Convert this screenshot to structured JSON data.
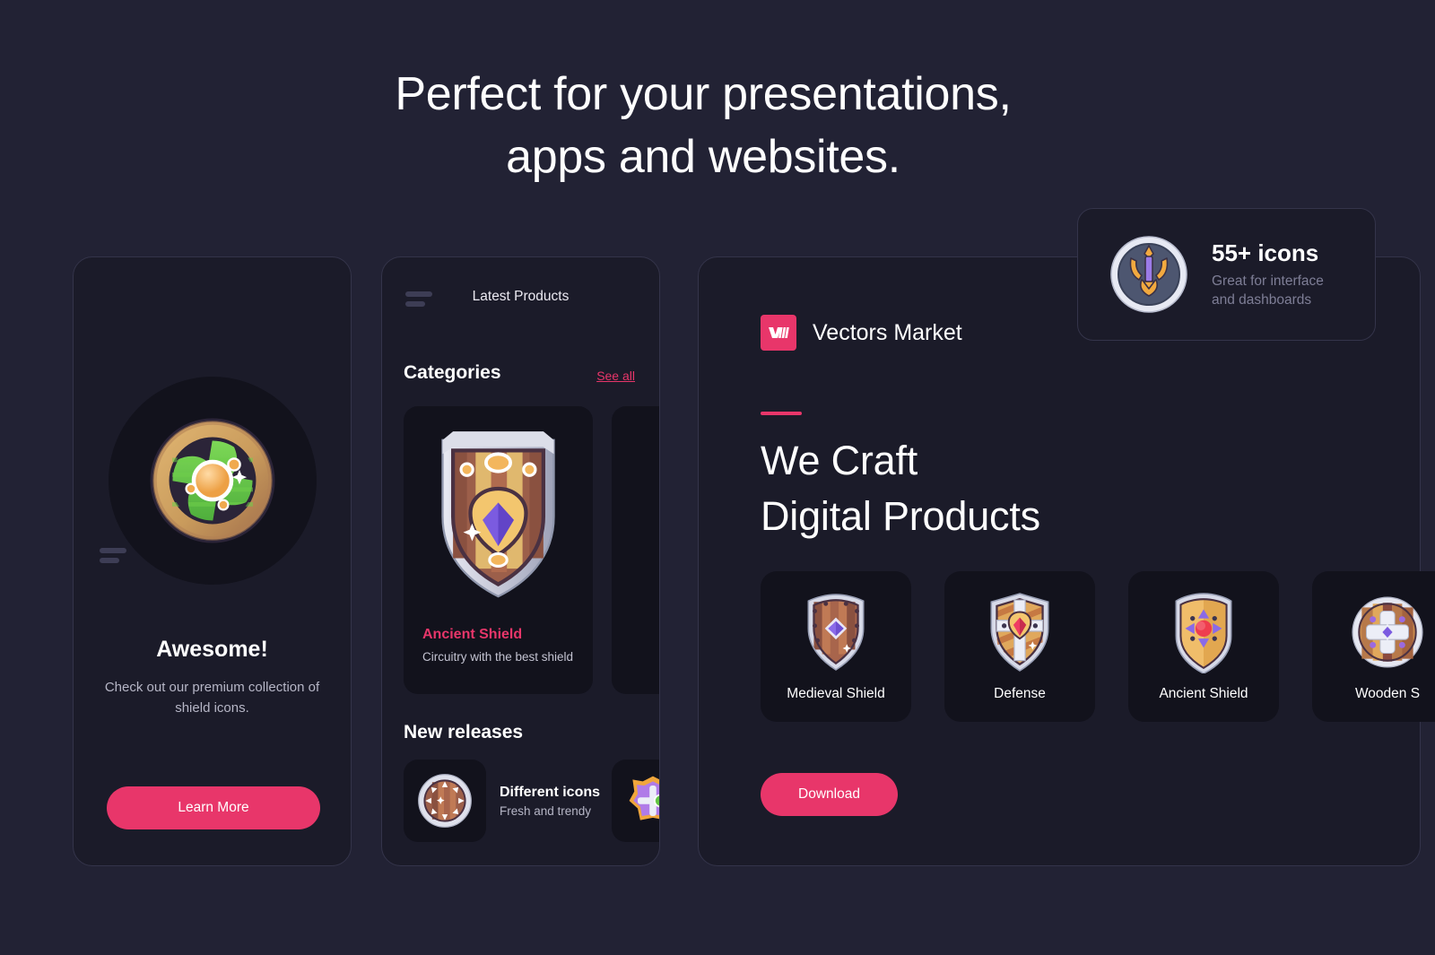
{
  "theme": {
    "page_bg": "#222234",
    "card_bg": "#1b1b29",
    "inner_bg": "#12121c",
    "accent": "#e8366a",
    "text_primary": "#ffffff",
    "text_muted": "#b6b6c6"
  },
  "headline": {
    "line1": "Perfect for your presentations,",
    "line2": "apps and websites."
  },
  "card_awesome": {
    "menu_icon": "hamburger-menu-icon",
    "hero_icon": "green-round-shield-icon",
    "title": "Awesome!",
    "subtitle_line1": "Check out our premium",
    "subtitle_line2": "collection of shield icons.",
    "button_label": "Learn More"
  },
  "card_products": {
    "menu_icon": "hamburger-menu-icon",
    "header": "Latest Products",
    "categories": {
      "section_title": "Categories",
      "see_all_label": "See all",
      "items": [
        {
          "icon": "ancient-wooden-shield-icon",
          "name": "Ancient Shield",
          "description": "Circuitry with the best shield"
        },
        {
          "icon": "",
          "name": "",
          "description": ""
        }
      ]
    },
    "new_releases": {
      "section_title": "New releases",
      "items": [
        {
          "icon": "round-wooden-shield-icon",
          "name": "Different icons",
          "subtitle": "Fresh and trendy"
        },
        {
          "icon": "purple-shield-icon",
          "name": "",
          "subtitle": ""
        }
      ]
    }
  },
  "panel_main": {
    "brand": {
      "logo_icon": "vectors-market-logo-icon",
      "name": "Vectors Market"
    },
    "heading_line1": "We Craft",
    "heading_line2": "Digital Products",
    "icons": [
      {
        "icon": "medieval-shield-icon",
        "label": "Medieval Shield"
      },
      {
        "icon": "defense-shield-icon",
        "label": "Defense"
      },
      {
        "icon": "ancient-shield-icon",
        "label": "Ancient Shield"
      },
      {
        "icon": "wooden-shield-icon",
        "label": "Wooden S"
      }
    ],
    "download_label": "Download"
  },
  "badge": {
    "icon": "trident-shield-icon",
    "title": "55+ icons",
    "subtitle_line1": "Great for interface",
    "subtitle_line2": "and dashboards"
  }
}
